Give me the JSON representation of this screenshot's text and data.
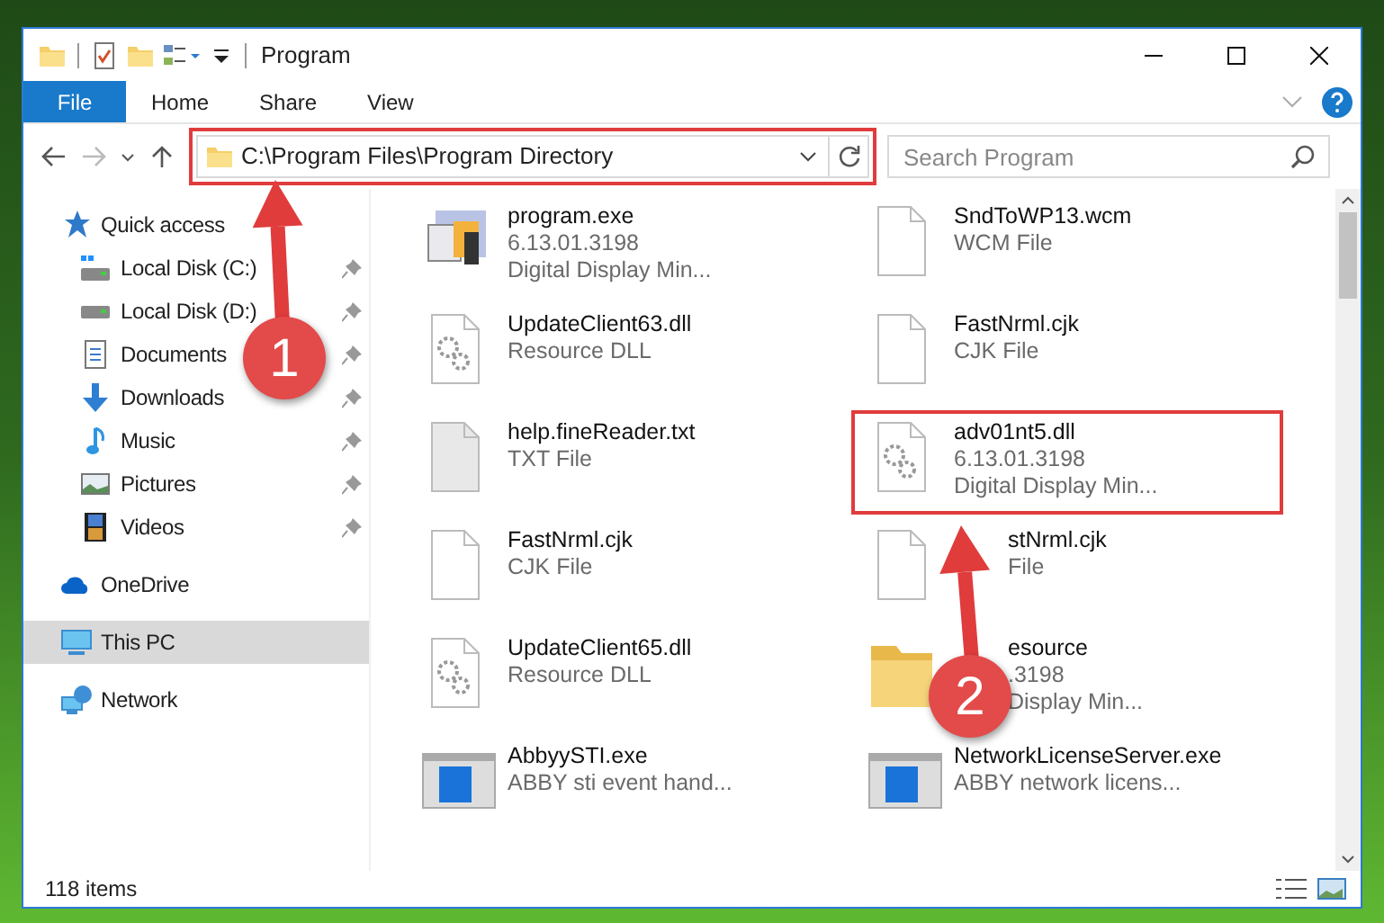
{
  "window": {
    "title": "Program"
  },
  "ribbon_tabs": [
    {
      "label": "File",
      "kind": "file"
    },
    {
      "label": "Home",
      "kind": "tab"
    },
    {
      "label": "Share",
      "kind": "tab"
    },
    {
      "label": "View",
      "kind": "tab"
    }
  ],
  "address": {
    "path": "C:\\Program Files\\Program Directory",
    "highlighted": true
  },
  "search": {
    "placeholder": "Search Program"
  },
  "nav": [
    {
      "label": "Quick access",
      "kind": "quick",
      "selected": false,
      "children": [
        {
          "label": "Local Disk (C:)",
          "kind": "disk-c",
          "pinned": true
        },
        {
          "label": "Local Disk (D:)",
          "kind": "disk",
          "pinned": true
        },
        {
          "label": "Documents",
          "kind": "docs",
          "pinned": true
        },
        {
          "label": "Downloads",
          "kind": "downloads",
          "pinned": true
        },
        {
          "label": "Music",
          "kind": "music",
          "pinned": true
        },
        {
          "label": "Pictures",
          "kind": "pictures",
          "pinned": true
        },
        {
          "label": "Videos",
          "kind": "videos",
          "pinned": true
        }
      ]
    },
    {
      "label": "OneDrive",
      "kind": "cloud",
      "selected": false
    },
    {
      "label": "This PC",
      "kind": "pc",
      "selected": true
    },
    {
      "label": "Network",
      "kind": "network",
      "selected": false
    }
  ],
  "files": [
    {
      "name": "program.exe",
      "details": [
        "6.13.01.3198",
        "Digital Display Min..."
      ],
      "kind": "exe",
      "highlighted": false,
      "covered": false
    },
    {
      "name": "SndToWP13.wcm",
      "details": [
        "WCM File"
      ],
      "kind": "blank",
      "highlighted": false,
      "covered": false
    },
    {
      "name": "UpdateClient63.dll",
      "details": [
        "Resource DLL"
      ],
      "kind": "dll",
      "highlighted": false,
      "covered": false
    },
    {
      "name": "FastNrml.cjk",
      "details": [
        "CJK File"
      ],
      "kind": "blank",
      "highlighted": false,
      "covered": false
    },
    {
      "name": "help.fineReader.txt",
      "details": [
        "TXT File"
      ],
      "kind": "grey",
      "highlighted": false,
      "covered": false
    },
    {
      "name": "adv01nt5.dll",
      "details": [
        "6.13.01.3198",
        "Digital Display Min..."
      ],
      "kind": "dll",
      "highlighted": true,
      "covered": false
    },
    {
      "name": "FastNrml.cjk",
      "details": [
        "CJK File"
      ],
      "kind": "blank",
      "highlighted": false,
      "covered": false
    },
    {
      "name": "stNrml.cjk",
      "details": [
        "File"
      ],
      "kind": "blank",
      "highlighted": false,
      "covered": true
    },
    {
      "name": "UpdateClient65.dll",
      "details": [
        "Resource DLL"
      ],
      "kind": "dll",
      "highlighted": false,
      "covered": false
    },
    {
      "name": "esource",
      "details": [
        ".3198",
        "Display Min..."
      ],
      "kind": "folder",
      "highlighted": false,
      "covered": true
    },
    {
      "name": "AbbyySTI.exe",
      "details": [
        "ABBY sti event hand..."
      ],
      "kind": "app",
      "highlighted": false,
      "covered": false
    },
    {
      "name": "NetworkLicenseServer.exe",
      "details": [
        "ABBY network licens..."
      ],
      "kind": "app",
      "highlighted": false,
      "covered": false
    }
  ],
  "annotations": [
    {
      "label": "1"
    },
    {
      "label": "2"
    }
  ],
  "status_bar": {
    "items": "118 items"
  }
}
